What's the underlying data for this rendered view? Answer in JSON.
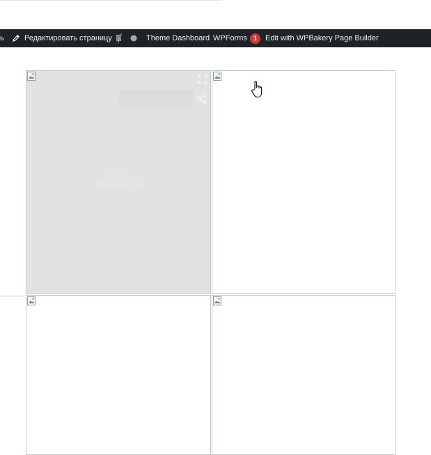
{
  "admin_bar": {
    "leading_fragment": "ь",
    "edit_page_label": "Редактировать страницу",
    "theme_dashboard_label": "Theme Dashboard",
    "wpforms_label": "WPForms",
    "wpforms_count": "1",
    "wpbakery_label": "Edit with WPBakery Page Builder",
    "icons": [
      "pencil-icon",
      "yoast-seo-icon",
      "status-dot-icon"
    ],
    "background_color": "#1d2327",
    "badge_color": "#d63638"
  },
  "gallery": {
    "tiles": [
      {
        "state": "loading-placeholder",
        "overlay_watermark_small": "RECOMMENDS",
        "overlay_watermark": "TANDOO",
        "icons": [
          "expand-icon",
          "share-icon"
        ]
      },
      {
        "state": "broken-image"
      },
      {
        "state": "broken-image"
      },
      {
        "state": "broken-image"
      }
    ]
  }
}
